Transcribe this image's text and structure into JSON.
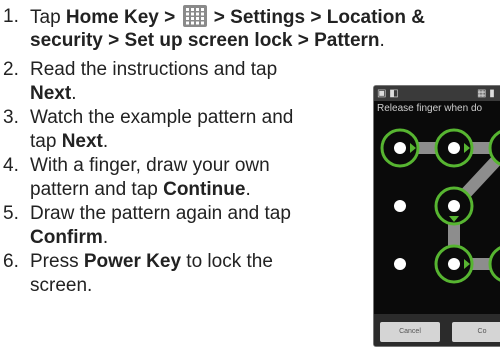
{
  "steps": [
    {
      "num": "1.",
      "parts": [
        {
          "t": "Tap ",
          "b": false
        },
        {
          "t": "Home Key > ",
          "b": true
        },
        {
          "icon": "apps-grid-icon"
        },
        {
          "t": " > Settings > Location &",
          "b": true
        }
      ],
      "line2": [
        {
          "t": "security > Set up screen lock > Pattern",
          "b": true
        },
        {
          "t": ".",
          "b": false
        }
      ]
    },
    {
      "num": "2.",
      "line1": [
        {
          "t": "Read the instructions and tap",
          "b": false
        }
      ],
      "line2": [
        {
          "t": "Next",
          "b": true
        },
        {
          "t": ".",
          "b": false
        }
      ]
    },
    {
      "num": "3.",
      "line1": [
        {
          "t": "Watch the example pattern and",
          "b": false
        }
      ],
      "line2": [
        {
          "t": "tap ",
          "b": false
        },
        {
          "t": "Next",
          "b": true
        },
        {
          "t": ".",
          "b": false
        }
      ]
    },
    {
      "num": "4.",
      "line1": [
        {
          "t": "With a finger, draw your own",
          "b": false
        }
      ],
      "line2": [
        {
          "t": "pattern and tap ",
          "b": false
        },
        {
          "t": "Continue",
          "b": true
        },
        {
          "t": ".",
          "b": false
        }
      ]
    },
    {
      "num": "5.",
      "line1": [
        {
          "t": "Draw the pattern again and tap",
          "b": false
        }
      ],
      "line2": [
        {
          "t": "Confirm",
          "b": true
        },
        {
          "t": ".",
          "b": false
        }
      ]
    },
    {
      "num": "6.",
      "line1": [
        {
          "t": "Press ",
          "b": false
        },
        {
          "t": "Power Key",
          "b": true
        },
        {
          "t": " to lock the",
          "b": false
        }
      ],
      "line2": [
        {
          "t": "screen.",
          "b": false
        }
      ]
    }
  ],
  "phone": {
    "hint": "Release finger when do",
    "status_left": "▣ ◧",
    "status_right": "▦ ▮",
    "cancel_label": "Cancel",
    "confirm_label": "Co",
    "pattern_color": "#57b531",
    "icons": {
      "status": "status-icons",
      "pattern": "unlock-pattern-dots"
    }
  },
  "colors": {
    "text": "#222222",
    "pattern_green": "#57b531",
    "phone_bg": "#0a0a0a"
  }
}
